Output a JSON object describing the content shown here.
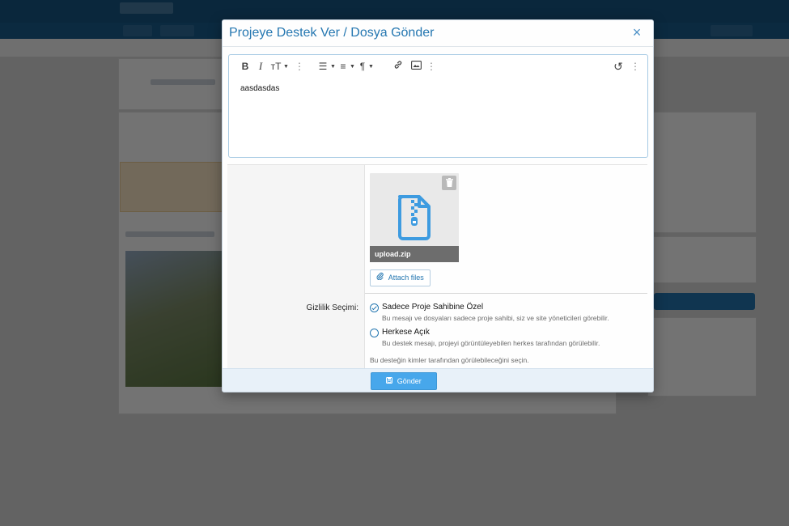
{
  "modal": {
    "title": "Projeye Destek Ver / Dosya Gönder",
    "close_icon": "×"
  },
  "editor": {
    "toolbar": [
      {
        "name": "bold-icon",
        "glyph": "B"
      },
      {
        "name": "italic-icon",
        "glyph": "I"
      },
      {
        "name": "font-size-icon",
        "glyph": "тT"
      },
      {
        "name": "more-text-icon",
        "glyph": "⋮"
      },
      {
        "name": "list-icon",
        "glyph": "☰"
      },
      {
        "name": "align-icon",
        "glyph": "≡"
      },
      {
        "name": "paragraph-icon",
        "glyph": "¶"
      },
      {
        "name": "link-icon",
        "glyph": "🔗"
      },
      {
        "name": "image-icon",
        "glyph": "▣"
      },
      {
        "name": "more-insert-icon",
        "glyph": "⋮"
      },
      {
        "name": "undo-icon",
        "glyph": "↺"
      },
      {
        "name": "more-options-icon",
        "glyph": "⋮"
      }
    ],
    "content": "aasdasdas"
  },
  "upload": {
    "file_name": "upload.zip",
    "delete_icon": "🗑",
    "attach_label": "Attach files"
  },
  "privacy": {
    "label": "Gizlilik Seçimi:",
    "options": [
      {
        "label": "Sadece Proje Sahibine Özel",
        "hint": "Bu mesajı ve dosyaları sadece proje sahibi, siz ve site yöneticileri görebilir.",
        "checked": true
      },
      {
        "label": "Herkese Açık",
        "hint": "Bu destek mesajı, projeyi görüntüleyebilen herkes tarafından görülebilir.",
        "checked": false
      }
    ],
    "explain": "Bu desteğin kimler tarafından görülebileceğini seçin."
  },
  "footer": {
    "submit_label": "Gönder"
  },
  "colors": {
    "accent": "#2577b1",
    "button": "#47a7eb",
    "footer_bg": "#e8f1f9"
  }
}
